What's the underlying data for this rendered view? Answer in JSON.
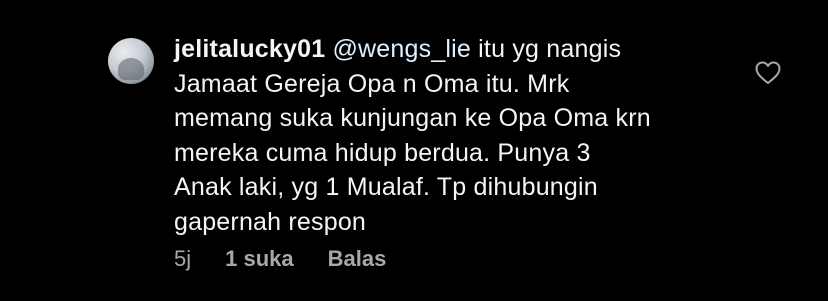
{
  "comment": {
    "username": "jelitalucky01",
    "mention": "@wengs_lie",
    "text": " itu yg nangis\nJamaat Gereja Opa n Oma itu. Mrk\nmemang suka kunjungan ke Opa Oma krn\nmereka cuma hidup berdua. Punya 3\nAnak laki, yg 1 Mualaf. Tp dihubungin\ngapernah respon",
    "time": "5j",
    "likes": "1 suka",
    "reply_label": "Balas"
  },
  "icons": {
    "like": "heart-outline-icon",
    "avatar": "profile-avatar"
  },
  "colors": {
    "background": "#000000",
    "text": "#f5f5f5",
    "mention": "#e0f1ff",
    "meta": "#a8a8a8"
  }
}
